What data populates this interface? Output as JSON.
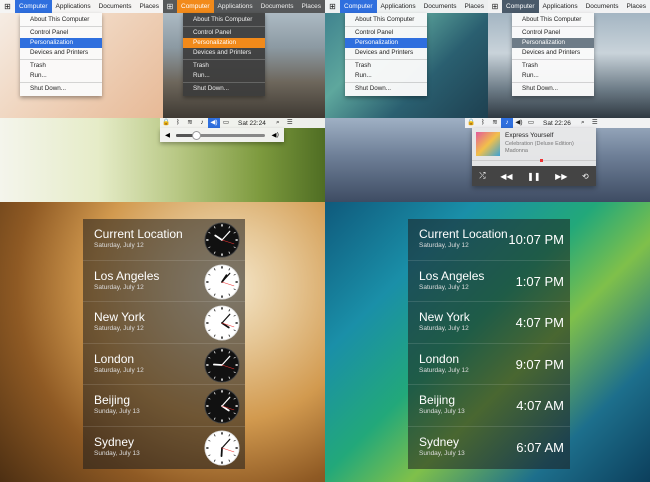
{
  "menu": {
    "logo_icon": "windows-logo-icon",
    "items": [
      "Computer",
      "Applications",
      "Documents",
      "Places"
    ],
    "dropdown": [
      "About This Computer",
      "Control Panel",
      "Personalization",
      "Devices and Printers",
      "Trash",
      "Run...",
      "Shut Down..."
    ]
  },
  "status": {
    "time_a": "Sat 22:24",
    "time_b": "Sat 22:26"
  },
  "music": {
    "title": "Express Yourself",
    "album": "Celebration (Deluxe Edition)",
    "artist": "Madonna"
  },
  "clocks": {
    "cities": [
      {
        "name": "Current Location",
        "date": "Saturday, July 12",
        "time": "10:07 PM"
      },
      {
        "name": "Los Angeles",
        "date": "Saturday, July 12",
        "time": "1:07 PM"
      },
      {
        "name": "New York",
        "date": "Saturday, July 12",
        "time": "4:07 PM"
      },
      {
        "name": "London",
        "date": "Saturday, July 12",
        "time": "9:07 PM"
      },
      {
        "name": "Beijing",
        "date": "Sunday, July 13",
        "time": "4:07 AM"
      },
      {
        "name": "Sydney",
        "date": "Sunday, July 13",
        "time": "6:07 AM"
      }
    ]
  },
  "colors": {
    "accent_blue": "#2f6fde",
    "accent_orange": "#f28a1a"
  }
}
